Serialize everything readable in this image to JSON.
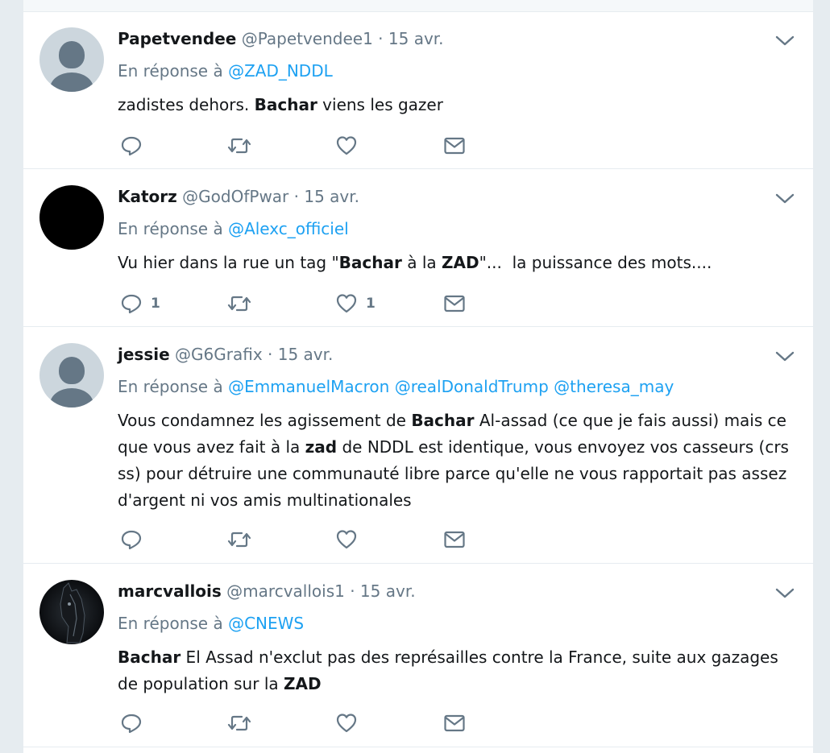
{
  "tweets": [
    {
      "fullname": "Papetvendee",
      "handle": "@Papetvendee1",
      "time": "15 avr.",
      "reply_prefix": "En réponse à",
      "mentions": [
        "@ZAD_NDDL"
      ],
      "segments": [
        {
          "t": "zadistes dehors. ",
          "b": false
        },
        {
          "t": "Bachar",
          "b": true
        },
        {
          "t": " viens les gazer",
          "b": false
        }
      ],
      "reply_count": "",
      "like_count": ""
    },
    {
      "fullname": "Katorz",
      "handle": "@GodOfPwar",
      "time": "15 avr.",
      "reply_prefix": "En réponse à",
      "mentions": [
        "@Alexc_officiel"
      ],
      "segments": [
        {
          "t": "Vu hier dans la rue un tag \"",
          "b": false
        },
        {
          "t": "Bachar",
          "b": true
        },
        {
          "t": " à la ",
          "b": false
        },
        {
          "t": "ZAD",
          "b": true
        },
        {
          "t": "\"...  la puissance des mots....",
          "b": false
        }
      ],
      "reply_count": "1",
      "like_count": "1"
    },
    {
      "fullname": "jessie",
      "handle": "@G6Grafix",
      "time": "15 avr.",
      "reply_prefix": "En réponse à",
      "mentions": [
        "@EmmanuelMacron",
        "@realDonaldTrump",
        "@theresa_may"
      ],
      "segments": [
        {
          "t": "Vous condamnez les agissement de ",
          "b": false
        },
        {
          "t": "Bachar",
          "b": true
        },
        {
          "t": " Al-assad (ce que je fais aussi) mais ce que vous avez fait à la ",
          "b": false
        },
        {
          "t": "zad",
          "b": true
        },
        {
          "t": " de NDDL est identique, vous envoyez vos casseurs (crs ss) pour détruire une communauté libre parce qu'elle ne vous rapportait pas assez d'argent ni vos amis multinationales",
          "b": false
        }
      ],
      "reply_count": "",
      "like_count": ""
    },
    {
      "fullname": "marcvallois",
      "handle": "@marcvallois1",
      "time": "15 avr.",
      "reply_prefix": "En réponse à",
      "mentions": [
        "@CNEWS"
      ],
      "segments": [
        {
          "t": "Bachar",
          "b": true
        },
        {
          "t": " El Assad n'exclut pas des représailles contre la France, suite aux gazages de population sur la ",
          "b": false
        },
        {
          "t": "ZAD",
          "b": true
        }
      ],
      "reply_count": "",
      "like_count": ""
    }
  ],
  "separator": "·",
  "icons": {
    "reply": "reply-icon",
    "retweet": "retweet-icon",
    "like": "heart-icon",
    "message": "envelope-icon",
    "menu": "chevron-down-icon"
  },
  "colors": {
    "link": "#1da1f2",
    "secondary": "#657786",
    "text": "#14171a",
    "background": "#e6ecf0"
  }
}
